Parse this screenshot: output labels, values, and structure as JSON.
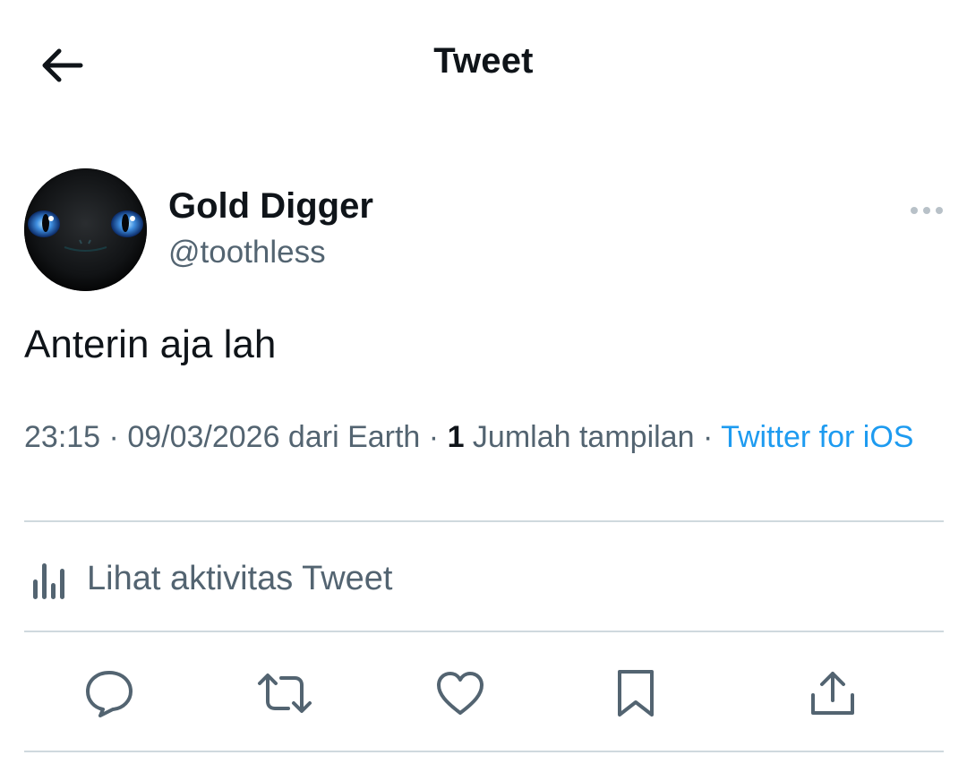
{
  "header": {
    "back_icon": "arrow-left-icon",
    "title": "Tweet"
  },
  "author": {
    "display_name": "Gold Digger",
    "handle": "@toothless",
    "avatar_icon": "black-dragon-face-avatar"
  },
  "more_icon": "ellipsis-icon",
  "tweet": {
    "text": "Anterin aja lah"
  },
  "meta": {
    "time": "23:15",
    "sep1": " · ",
    "date": "09/03/2026",
    "location": " dari Earth",
    "sep2": " · ",
    "view_count": "1",
    "view_label": " Jumlah tampilan",
    "sep3": " · ",
    "source": "Twitter for iOS"
  },
  "activity": {
    "icon": "analytics-bars-icon",
    "label": "Lihat aktivitas Tweet"
  },
  "actions": [
    {
      "name": "reply",
      "icon": "comment-bubble-icon"
    },
    {
      "name": "retweet",
      "icon": "retweet-arrows-icon"
    },
    {
      "name": "like",
      "icon": "heart-icon"
    },
    {
      "name": "bookmark",
      "icon": "bookmark-icon"
    },
    {
      "name": "share",
      "icon": "share-upload-icon"
    }
  ],
  "colors": {
    "text_primary": "#0f1419",
    "text_secondary": "#536471",
    "accent": "#1d9bf0",
    "divider": "#cfd9de"
  }
}
